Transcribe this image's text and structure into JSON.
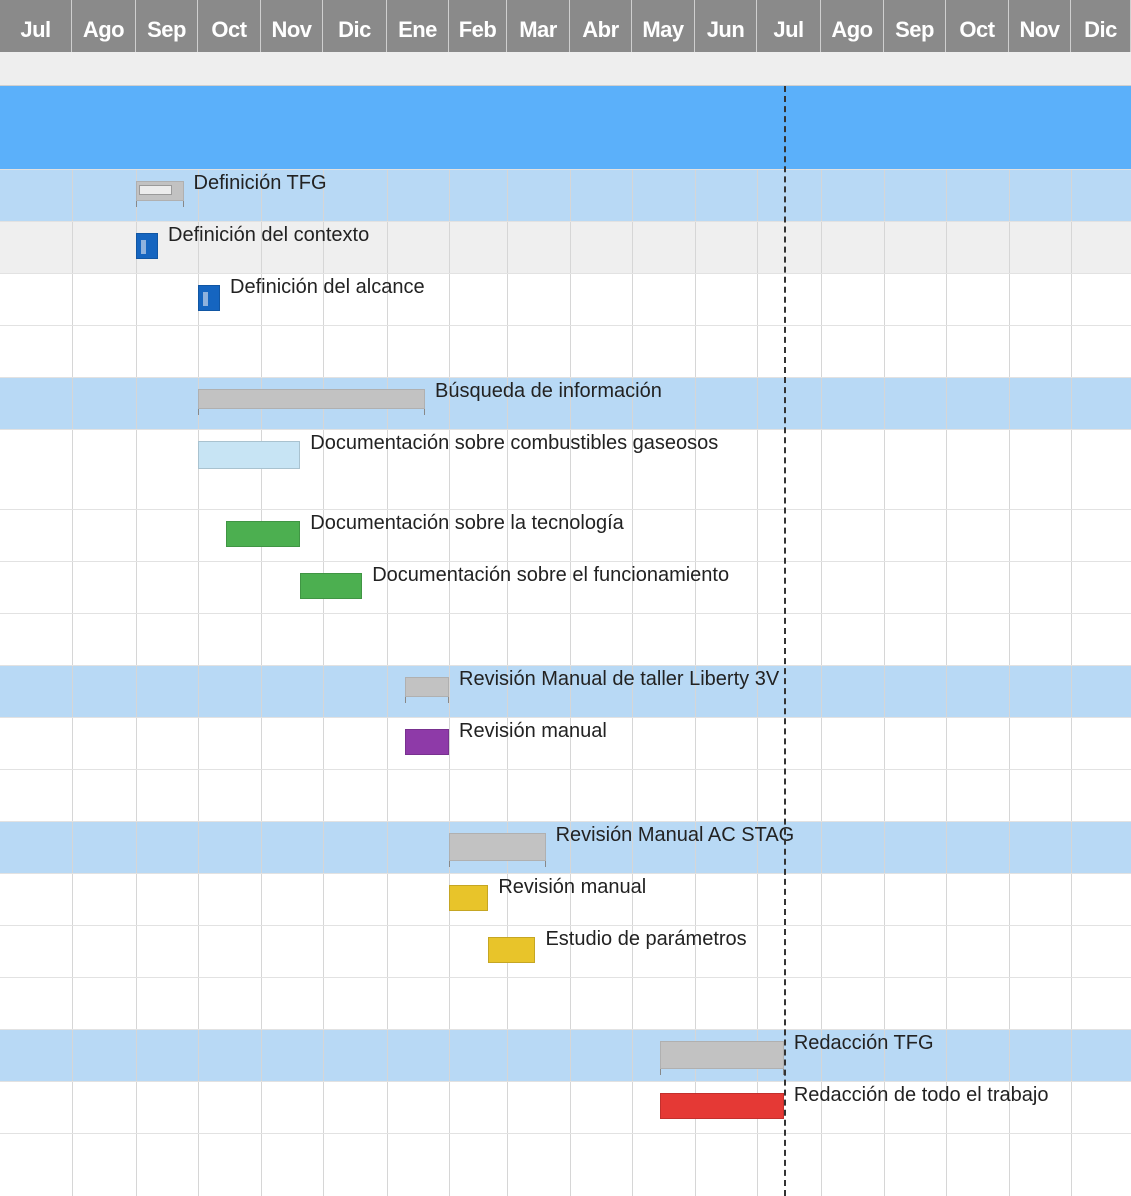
{
  "timeline": {
    "months": [
      "Jul",
      "Ago",
      "Sep",
      "Oct",
      "Nov",
      "Dic",
      "Ene",
      "Feb",
      "Mar",
      "Abr",
      "May",
      "Jun",
      "Jul",
      "Ago",
      "Sep",
      "Oct",
      "Nov",
      "Dic"
    ],
    "start": "2017-07",
    "today": "2018-07-14"
  },
  "colors": {
    "header": "#8a8a8a",
    "project_row": "#5bb0fa",
    "summary_row": "#b8d9f5",
    "summary_bar": "#c2c2c2",
    "blue_task": "#1565c0",
    "light_blue_task": "#c7e4f4",
    "green_task": "#4caf50",
    "purple_task": "#8e3aa8",
    "yellow_task": "#e8c42a",
    "red_task": "#e53935"
  },
  "chart_data": {
    "type": "table",
    "tasks": [
      {
        "name": "",
        "kind": "project"
      },
      {
        "name": "Definición TFG",
        "kind": "summary",
        "start": "2017-09-01",
        "end": "2017-09-24",
        "progress": 0.75
      },
      {
        "name": "Definición del contexto",
        "kind": "task",
        "start": "2017-09-01",
        "end": "2017-09-10",
        "color": "#1565c0",
        "progress": 0.5
      },
      {
        "name": "Definición del alcance",
        "kind": "task",
        "start": "2017-10-01",
        "end": "2017-10-10",
        "color": "#1565c0",
        "progress": 0.5
      },
      {
        "name": "",
        "kind": "blank"
      },
      {
        "name": "Búsqueda de información",
        "kind": "summary",
        "start": "2017-10-01",
        "end": "2018-01-20",
        "progress": 0
      },
      {
        "name": "Documentación sobre combustibles gaseosos",
        "kind": "task",
        "start": "2017-10-01",
        "end": "2017-11-20",
        "color": "#c7e4f4",
        "height": "tall"
      },
      {
        "name": "Documentación sobre la tecnología",
        "kind": "task",
        "start": "2017-10-15",
        "end": "2017-11-20",
        "color": "#4caf50"
      },
      {
        "name": "Documentación sobre el funcionamiento",
        "kind": "task",
        "start": "2017-11-20",
        "end": "2017-12-20",
        "color": "#4caf50"
      },
      {
        "name": "",
        "kind": "blank"
      },
      {
        "name": "Revisión Manual de taller Liberty 3V",
        "kind": "summary",
        "start": "2018-01-10",
        "end": "2018-02-01",
        "progress": 0
      },
      {
        "name": "Revisión manual",
        "kind": "task",
        "start": "2018-01-10",
        "end": "2018-02-01",
        "color": "#8e3aa8"
      },
      {
        "name": "",
        "kind": "blank"
      },
      {
        "name": "Revisión Manual AC STAG",
        "kind": "summary",
        "start": "2018-02-01",
        "end": "2018-03-20",
        "progress": 0
      },
      {
        "name": "Revisión manual",
        "kind": "task",
        "start": "2018-02-01",
        "end": "2018-02-20",
        "color": "#e8c42a"
      },
      {
        "name": "Estudio de parámetros",
        "kind": "task",
        "start": "2018-02-20",
        "end": "2018-03-15",
        "color": "#e8c42a"
      },
      {
        "name": "",
        "kind": "blank"
      },
      {
        "name": "Redacción TFG",
        "kind": "summary",
        "start": "2018-05-15",
        "end": "2018-07-14",
        "progress": 0
      },
      {
        "name": "Redacción de todo el trabajo",
        "kind": "task",
        "start": "2018-05-15",
        "end": "2018-07-14",
        "color": "#e53935"
      },
      {
        "name": "",
        "kind": "blank"
      }
    ]
  }
}
